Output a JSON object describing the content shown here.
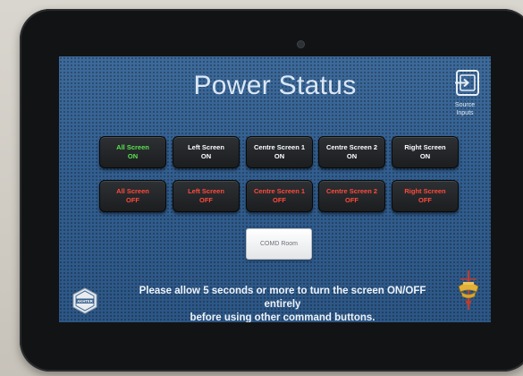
{
  "header": {
    "title": "Power Status",
    "source_inputs_label_line1": "Source",
    "source_inputs_label_line2": "Inputs",
    "source_icon": "input-arrow-icon"
  },
  "on_buttons": [
    {
      "line1": "All Screen",
      "line2": "ON"
    },
    {
      "line1": "Left Screen",
      "line2": "ON"
    },
    {
      "line1": "Centre Screen 1",
      "line2": "ON"
    },
    {
      "line1": "Centre Screen 2",
      "line2": "ON"
    },
    {
      "line1": "Right Screen",
      "line2": "ON"
    }
  ],
  "off_buttons": [
    {
      "line1": "All Screen",
      "line2": "OFF"
    },
    {
      "line1": "Left Screen",
      "line2": "OFF"
    },
    {
      "line1": "Centre Screen 1",
      "line2": "OFF"
    },
    {
      "line1": "Centre Screen 2",
      "line2": "OFF"
    },
    {
      "line1": "Right Screen",
      "line2": "OFF"
    }
  ],
  "room_button": "COMD Room",
  "notice": {
    "line1": "Please allow 5 seconds or more to turn the screen ON/OFF entirely",
    "line2": "before using other command buttons."
  },
  "logos": {
    "left": "akhter-badge-logo",
    "left_text": "AKHTER",
    "right": "crest-emblem-logo"
  },
  "colors": {
    "screen_bg": "#325e8f",
    "on_accent": "#59e34f",
    "off_accent": "#ff4a3c"
  }
}
